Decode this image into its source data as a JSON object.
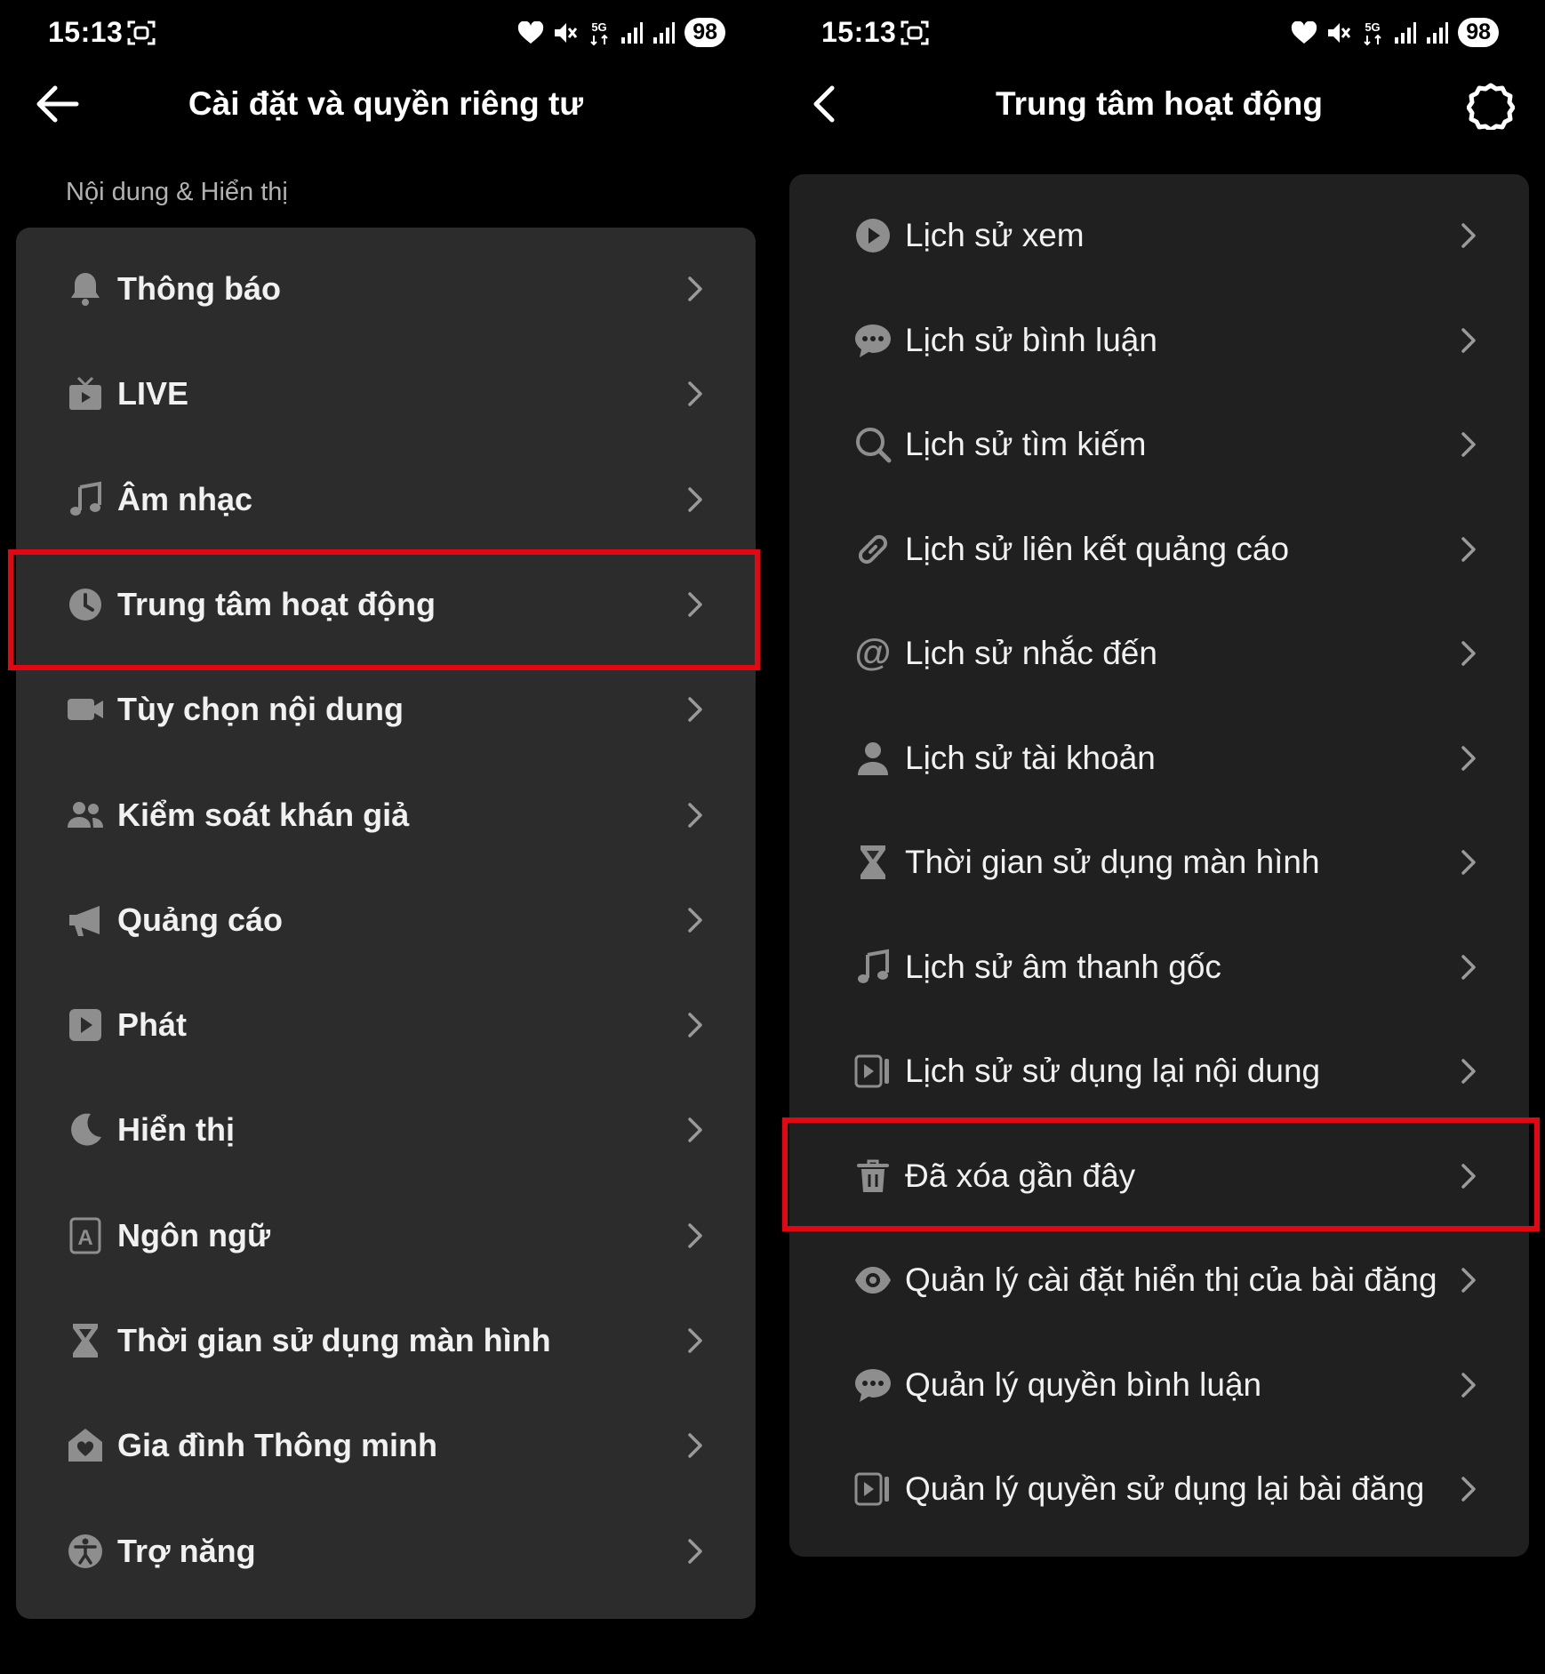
{
  "status": {
    "time": "15:13",
    "network": "5G",
    "battery": "98"
  },
  "left": {
    "title": "Cài đặt và quyền riêng tư",
    "section": "Nội dung & Hiển thị",
    "items": [
      {
        "label": "Thông báo",
        "icon": "bell-icon"
      },
      {
        "label": "LIVE",
        "icon": "tv-icon"
      },
      {
        "label": "Âm nhạc",
        "icon": "music-note-icon"
      },
      {
        "label": "Trung tâm hoạt động",
        "icon": "clock-icon"
      },
      {
        "label": "Tùy chọn nội dung",
        "icon": "video-camera-icon"
      },
      {
        "label": "Kiểm soát khán giả",
        "icon": "users-icon"
      },
      {
        "label": "Quảng cáo",
        "icon": "megaphone-icon"
      },
      {
        "label": "Phát",
        "icon": "play-square-icon"
      },
      {
        "label": "Hiển thị",
        "icon": "moon-icon"
      },
      {
        "label": "Ngôn ngữ",
        "icon": "language-icon"
      },
      {
        "label": "Thời gian sử dụng màn hình",
        "icon": "hourglass-icon"
      },
      {
        "label": "Gia đình Thông minh",
        "icon": "home-heart-icon"
      },
      {
        "label": "Trợ năng",
        "icon": "accessibility-icon"
      }
    ]
  },
  "right": {
    "title": "Trung tâm hoạt động",
    "items": [
      {
        "label": "Lịch sử xem",
        "icon": "play-circle-icon"
      },
      {
        "label": "Lịch sử bình luận",
        "icon": "comment-icon"
      },
      {
        "label": "Lịch sử tìm kiếm",
        "icon": "search-icon"
      },
      {
        "label": "Lịch sử liên kết quảng cáo",
        "icon": "link-icon"
      },
      {
        "label": "Lịch sử nhắc đến",
        "icon": "at-icon"
      },
      {
        "label": "Lịch sử tài khoản",
        "icon": "person-icon"
      },
      {
        "label": "Thời gian sử dụng màn hình",
        "icon": "hourglass-icon"
      },
      {
        "label": "Lịch sử âm thanh gốc",
        "icon": "music-note-icon"
      },
      {
        "label": "Lịch sử sử dụng lại nội dung",
        "icon": "reuse-icon"
      },
      {
        "label": "Đã xóa gần đây",
        "icon": "trash-icon"
      },
      {
        "label": "Quản lý cài đặt hiển thị của bài đăng",
        "icon": "eye-icon"
      },
      {
        "label": "Quản lý quyền bình luận",
        "icon": "comment-icon"
      },
      {
        "label": "Quản lý quyền sử dụng lại bài đăng",
        "icon": "reuse-icon"
      }
    ]
  },
  "colors": {
    "highlight": "#e30613",
    "panel_left": "#2c2c2c",
    "panel_right": "#202020",
    "icon": "#8e8e8e"
  }
}
